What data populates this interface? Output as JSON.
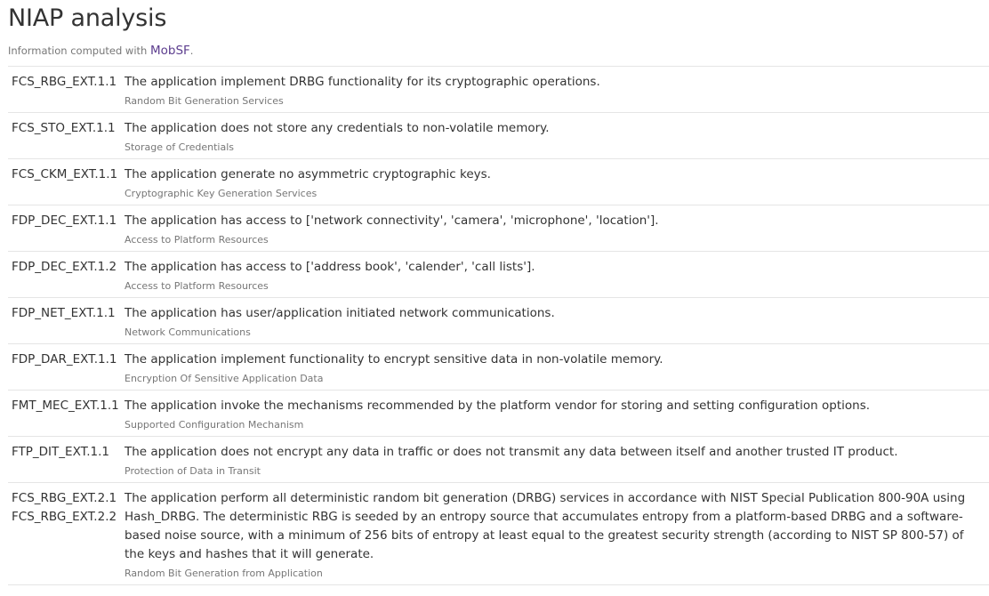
{
  "page": {
    "title": "NIAP analysis",
    "subtitle_prefix": "Information computed with ",
    "subtitle_link": "MobSF",
    "subtitle_suffix": "."
  },
  "rows": [
    {
      "ids": [
        "FCS_RBG_EXT.1.1"
      ],
      "description": "The application implement DRBG functionality for its cryptographic operations.",
      "category": "Random Bit Generation Services"
    },
    {
      "ids": [
        "FCS_STO_EXT.1.1"
      ],
      "description": "The application does not store any credentials to non-volatile memory.",
      "category": "Storage of Credentials"
    },
    {
      "ids": [
        "FCS_CKM_EXT.1.1"
      ],
      "description": "The application generate no asymmetric cryptographic keys.",
      "category": "Cryptographic Key Generation Services"
    },
    {
      "ids": [
        "FDP_DEC_EXT.1.1"
      ],
      "description": "The application has access to ['network connectivity', 'camera', 'microphone', 'location'].",
      "category": "Access to Platform Resources"
    },
    {
      "ids": [
        "FDP_DEC_EXT.1.2"
      ],
      "description": "The application has access to ['address book', 'calender', 'call lists'].",
      "category": "Access to Platform Resources"
    },
    {
      "ids": [
        "FDP_NET_EXT.1.1"
      ],
      "description": "The application has user/application initiated network communications.",
      "category": "Network Communications"
    },
    {
      "ids": [
        "FDP_DAR_EXT.1.1"
      ],
      "description": "The application implement functionality to encrypt sensitive data in non-volatile memory.",
      "category": "Encryption Of Sensitive Application Data"
    },
    {
      "ids": [
        "FMT_MEC_EXT.1.1"
      ],
      "description": "The application invoke the mechanisms recommended by the platform vendor for storing and setting configuration options.",
      "category": "Supported Configuration Mechanism"
    },
    {
      "ids": [
        "FTP_DIT_EXT.1.1"
      ],
      "description": "The application does not encrypt any data in traffic or does not transmit any data between itself and another trusted IT product.",
      "category": "Protection of Data in Transit"
    },
    {
      "ids": [
        "FCS_RBG_EXT.2.1",
        "FCS_RBG_EXT.2.2"
      ],
      "description": "The application perform all deterministic random bit generation (DRBG) services in accordance with NIST Special Publication 800-90A using Hash_DRBG. The deterministic RBG is seeded by an entropy source that accumulates entropy from a platform-based DRBG and a software-based noise source, with a minimum of 256 bits of entropy at least equal to the greatest security strength (according to NIST SP 800-57) of the keys and hashes that it will generate.",
      "category": "Random Bit Generation from Application"
    }
  ]
}
